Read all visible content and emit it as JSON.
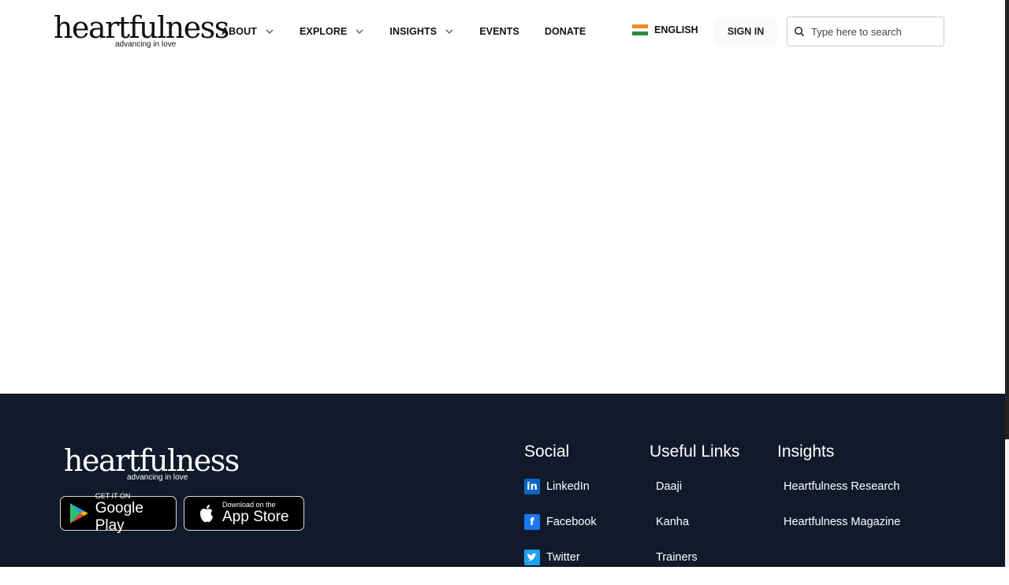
{
  "brand": {
    "name": "heartfulness",
    "tagline": "advancing in love"
  },
  "nav": {
    "items": [
      {
        "label": "ABOUT",
        "has_dropdown": true
      },
      {
        "label": "EXPLORE",
        "has_dropdown": true
      },
      {
        "label": "INSIGHTS",
        "has_dropdown": true
      },
      {
        "label": "EVENTS",
        "has_dropdown": false
      },
      {
        "label": "DONATE",
        "has_dropdown": false
      }
    ]
  },
  "header": {
    "language": "ENGLISH",
    "language_flag": "india-flag-icon",
    "signin_label": "SIGN IN",
    "search_placeholder": "Type here to search"
  },
  "footer": {
    "brand": {
      "name": "heartfulness",
      "tagline": "advancing in love"
    },
    "stores": {
      "google_small": "GET IT ON",
      "google_big": "Google Play",
      "apple_small": "Download on the",
      "apple_big": "App Store"
    },
    "social": {
      "heading": "Social",
      "links": [
        "LinkedIn",
        "Facebook",
        "Twitter"
      ]
    },
    "useful": {
      "heading": "Useful Links",
      "links": [
        "Daaji",
        "Kanha",
        "Trainers"
      ]
    },
    "insights": {
      "heading": "Insights",
      "links": [
        "Heartfulness Research",
        "Heartfulness Magazine"
      ]
    }
  },
  "colors": {
    "footer_bg": "#111a2b",
    "linkedin": "#0a66c2",
    "facebook": "#1877f2",
    "twitter": "#1da1f2"
  }
}
